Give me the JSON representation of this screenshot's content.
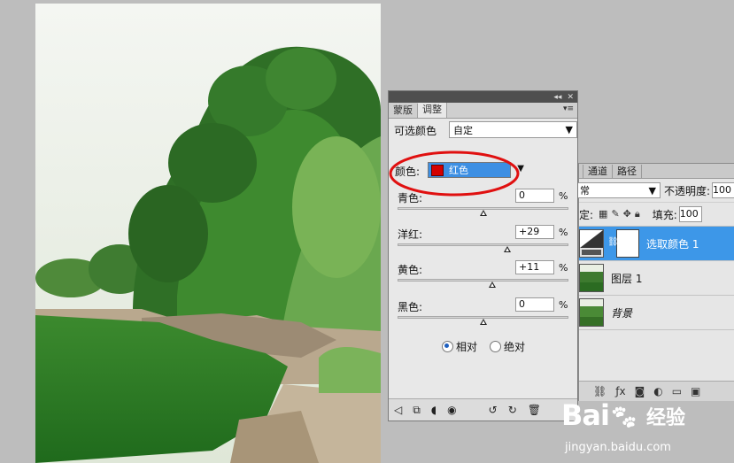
{
  "adjustments": {
    "tabs": [
      "蒙版",
      "调整"
    ],
    "active_tab": "调整",
    "preset_label": "可选颜色",
    "preset_value": "自定",
    "color_label": "颜色:",
    "color_value": "红色",
    "color_swatch": "#d40000",
    "sliders": [
      {
        "name": "青色:",
        "value": "0",
        "unit": "%",
        "level": 0
      },
      {
        "name": "洋红:",
        "value": "+29",
        "unit": "%",
        "level": 29
      },
      {
        "name": "黄色:",
        "value": "+11",
        "unit": "%",
        "level": 11
      },
      {
        "name": "黑色:",
        "value": "0",
        "unit": "%",
        "level": 0
      }
    ],
    "method_relative": "相对",
    "method_absolute": "绝对",
    "method_selected": "relative"
  },
  "layers": {
    "tabs": [
      "通道",
      "路径"
    ],
    "blend_mode": "常",
    "opacity_label": "不透明度:",
    "opacity_value": "100",
    "lock_label": "定:",
    "fill_label": "填充:",
    "fill_value": "100",
    "items": [
      {
        "name": "选取颜色 1",
        "selected": true
      },
      {
        "name": "图层 1",
        "selected": false
      },
      {
        "name": "背景",
        "selected": false
      }
    ]
  },
  "watermark": {
    "brand": "Bai",
    "brand_suffix": "经验",
    "url": "jingyan.baidu.com"
  },
  "colors": {
    "accent": "#3d97e8",
    "highlight_circle": "#e01010"
  }
}
